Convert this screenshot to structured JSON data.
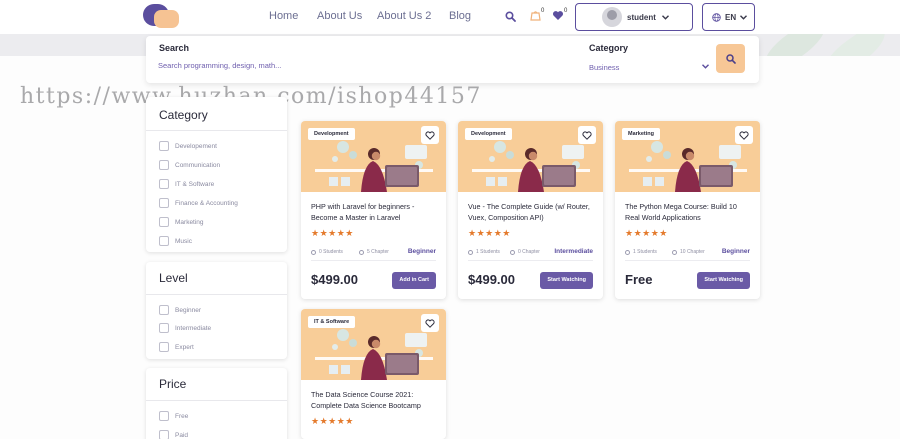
{
  "nav": {
    "links": [
      "Home",
      "About Us",
      "About Us 2",
      "Blog"
    ],
    "cart_count": "0",
    "wishlist_count": "0",
    "user_label": "student",
    "language": "EN"
  },
  "search": {
    "label": "Search",
    "placeholder": "Search programming, design, math...",
    "category_label": "Category",
    "category_value": "Business"
  },
  "watermark": "https://www.huzhan.com/ishop44157",
  "filters": {
    "category": {
      "title": "Category",
      "options": [
        "Developement",
        "Communication",
        "IT & Software",
        "Finance & Accounting",
        "Marketing",
        "Music"
      ]
    },
    "level": {
      "title": "Level",
      "options": [
        "Beginner",
        "Intermediate",
        "Expert"
      ]
    },
    "price": {
      "title": "Price",
      "options": [
        "Free",
        "Paid"
      ]
    }
  },
  "courses": [
    {
      "tag": "Development",
      "title": "PHP with Laravel for beginners - Become a Master in Laravel",
      "rating": 5,
      "students": "0 Students",
      "chapters": "5 Chapter",
      "level": "Beginner",
      "price": "$499.00",
      "action": "Add in Cart"
    },
    {
      "tag": "Development",
      "title": "Vue - The Complete Guide (w/ Router, Vuex, Composition API)",
      "rating": 5,
      "students": "1 Students",
      "chapters": "0 Chapter",
      "level": "Intermediate",
      "price": "$499.00",
      "action": "Start Watching"
    },
    {
      "tag": "Marketing",
      "title": "The Python Mega Course: Build 10 Real World Applications",
      "rating": 5,
      "students": "1 Students",
      "chapters": "10 Chapter",
      "level": "Beginner",
      "price": "Free",
      "action": "Start Watching"
    },
    {
      "tag": "IT & Software",
      "title": "The Data Science Course 2021: Complete Data Science Bootcamp",
      "rating": 5
    }
  ],
  "colors": {
    "brand_purple": "#5b4e9e",
    "thumb_peach": "#f8cd98",
    "star_orange": "#e47a2c"
  }
}
